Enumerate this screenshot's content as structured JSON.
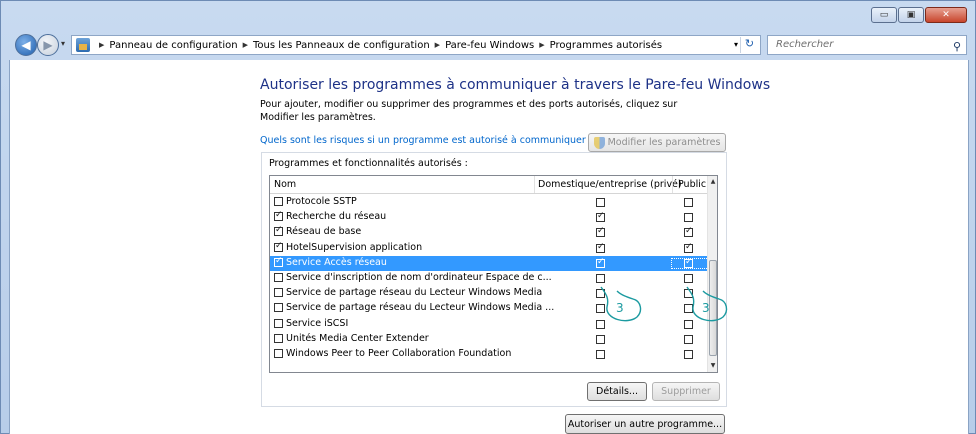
{
  "window": {
    "minimize": "▭",
    "maximize": "▣",
    "close": "✕"
  },
  "nav": {
    "back": "◀",
    "forward": "▶",
    "dropdown": "▾",
    "breadcrumbs": [
      "Panneau de configuration",
      "Tous les Panneaux de configuration",
      "Pare-feu Windows",
      "Programmes autorisés"
    ],
    "refresh_icon": "↻",
    "search_placeholder": "Rechercher",
    "search_icon": "⚲"
  },
  "page": {
    "title": "Autoriser les programmes à communiquer à travers le Pare-feu Windows",
    "description": "Pour ajouter, modifier ou supprimer des programmes et des ports autorisés, cliquez sur Modifier les paramètres.",
    "risk_link": "Quels sont les risques si un programme est autorisé à communiquer ?",
    "modify_button": "Modifier les paramètres"
  },
  "programs": {
    "group_title": "Programmes et fonctionnalités autorisés :",
    "columns": {
      "name": "Nom",
      "domestic": "Domestique/entreprise (privé)",
      "public": "Public"
    },
    "rows": [
      {
        "name": "Protocole SSTP",
        "enabled": false,
        "private": false,
        "public": false
      },
      {
        "name": "Recherche du réseau",
        "enabled": true,
        "private": true,
        "public": false
      },
      {
        "name": "Réseau de base",
        "enabled": true,
        "private": true,
        "public": true
      },
      {
        "name": "HotelSupervision application",
        "enabled": true,
        "private": true,
        "public": true
      },
      {
        "name": "Service Accès réseau",
        "enabled": true,
        "private": true,
        "public": true,
        "selected": true
      },
      {
        "name": "Service d'inscription de nom d'ordinateur Espace de c...",
        "enabled": false,
        "private": false,
        "public": false
      },
      {
        "name": "Service de partage réseau du Lecteur Windows Media",
        "enabled": false,
        "private": false,
        "public": false
      },
      {
        "name": "Service de partage réseau du Lecteur Windows Media ...",
        "enabled": false,
        "private": false,
        "public": false
      },
      {
        "name": "Service iSCSI",
        "enabled": false,
        "private": false,
        "public": false
      },
      {
        "name": "Unités Media Center Extender",
        "enabled": false,
        "private": false,
        "public": false
      },
      {
        "name": "Windows Peer to Peer Collaboration Foundation",
        "enabled": false,
        "private": false,
        "public": false
      }
    ],
    "details_button": "Détails...",
    "remove_button": "Supprimer",
    "allow_other_button": "Autoriser un autre programme..."
  },
  "callouts": [
    "3",
    "3"
  ]
}
